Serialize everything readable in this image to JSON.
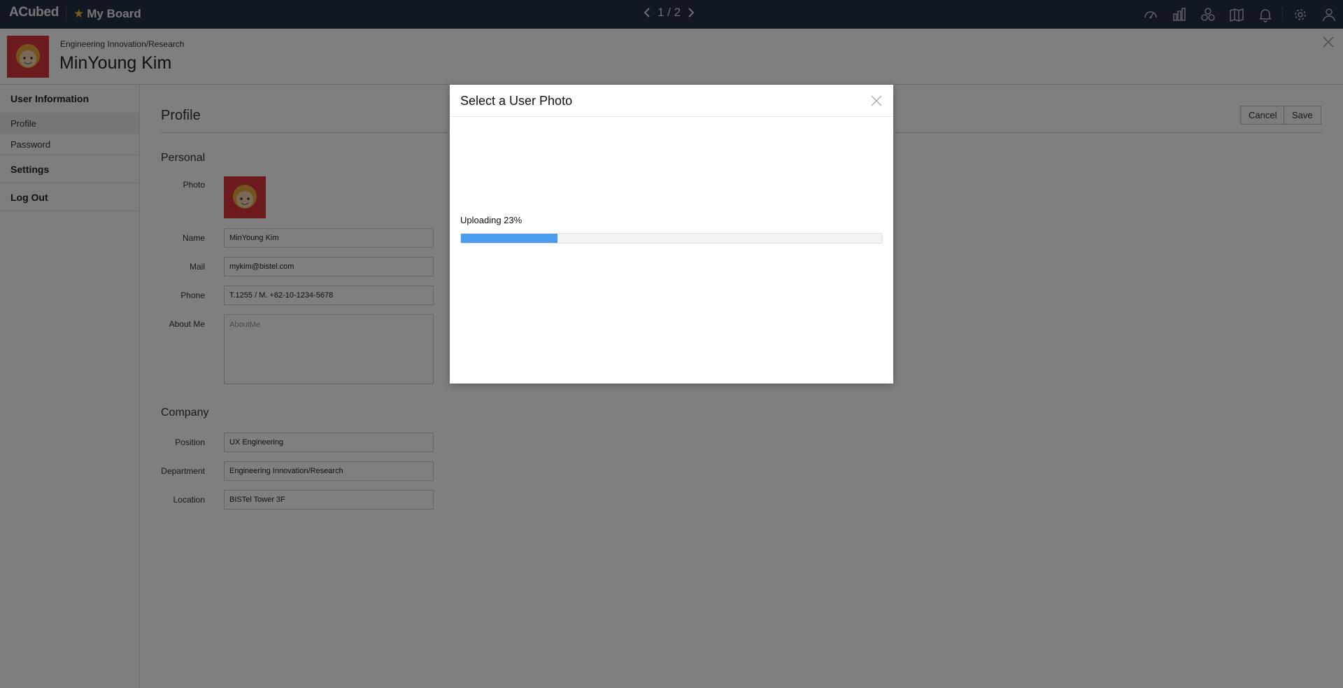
{
  "app": {
    "brand": "ACubed",
    "board_label": "My Board",
    "pager_text": "1 / 2"
  },
  "nav_icons": [
    "dashboard-icon",
    "bar-chart-icon",
    "cubes-icon",
    "map-icon",
    "bell-icon",
    "gear-icon",
    "user-icon"
  ],
  "header": {
    "department": "Engineering Innovation/Research",
    "name": "MinYoung Kim"
  },
  "sidebar": {
    "sections": [
      {
        "label": "User Information",
        "items": [
          {
            "label": "Profile",
            "active": true
          },
          {
            "label": "Password",
            "active": false
          }
        ]
      },
      {
        "label": "Settings",
        "items": []
      },
      {
        "label": "Log Out",
        "items": []
      }
    ]
  },
  "main": {
    "title": "Profile",
    "cancel_label": "Cancel",
    "save_label": "Save",
    "personal_heading": "Personal",
    "company_heading": "Company",
    "fields": {
      "photo_label": "Photo",
      "name_label": "Name",
      "name_value": "MinYoung Kim",
      "mail_label": "Mail",
      "mail_value": "mykim@bistel.com",
      "phone_label": "Phone",
      "phone_value": "T.1255 / M. +82-10-1234-5678",
      "about_label": "About Me",
      "about_placeholder": "AboutMe",
      "position_label": "Position",
      "position_value": "UX Engineering",
      "department_label": "Department",
      "department_value": "Engineering Innovation/Research",
      "location_label": "Location",
      "location_value": "BISTel Tower 3F"
    }
  },
  "modal": {
    "title": "Select a User Photo",
    "status": "Uploading 23%",
    "progress": 0.23
  },
  "colors": {
    "topbar": "#253142",
    "avatar_bg": "#d9343a",
    "progress_fill": "#4a9cf0",
    "star": "#f0b429"
  }
}
